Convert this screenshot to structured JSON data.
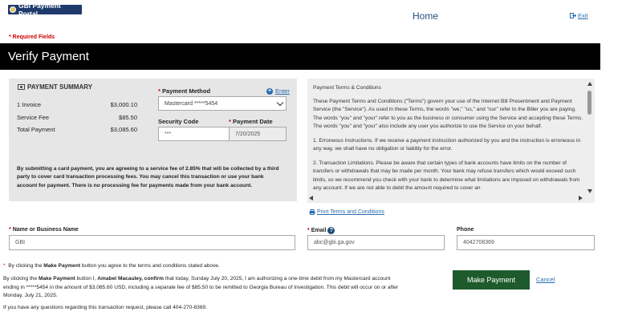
{
  "header": {
    "logo_text": "GBI Payment Portal",
    "home_label": "Home",
    "exit_label": "Exit"
  },
  "required_note": "* Required Fields",
  "banner_title": "Verify Payment",
  "summary": {
    "title": "PAYMENT SUMMARY",
    "rows": [
      {
        "label": "1 Invoice",
        "value": "$3,000.10"
      },
      {
        "label": "Service Fee",
        "value": "$85.50"
      },
      {
        "label": "Total Payment",
        "value": "$3,085.60"
      }
    ],
    "disclaimer": "By submitting a card payment, you are agreeing to a service fee of 2.85% that will be collected by a third party to cover card transaction processing fees. You may cancel this transaction or use your bank account for payment. There is no processing fee for payments made from your bank account."
  },
  "payment": {
    "method_label": "Payment Method",
    "enter_label": "Enter",
    "method_value": "Mastercard *****5454",
    "security_label": "Security Code",
    "security_value": "***",
    "date_label": "Payment Date",
    "date_value": "7/20/2025"
  },
  "terms": {
    "title": "Payment Terms & Conditions",
    "paragraphs": [
      "These Payment Terms and Conditions (\"Terms\") govern your use of the Internet Bill Presentment and Payment Service (the \"Service\"). As used in these Terms, the words \"we,\" \"us,\" and \"our\" refer to the Biller you are paying. The words \"you\" and \"your\" refer to you as the business or consumer using the Service and accepting these Terms. The words \"you\" and \"your\" also include any user you authorize to use the Service on your behalf.",
      "1. Erroneous Instructions. If we receive a payment instruction authorized by you and the instruction is erroneous in any way, we shall have no obligation or liability for the error.",
      "2. Transaction Limitations. Please be aware that certain types of bank accounts have limits on the number of transfers or withdrawals that may be made per month. Your bank may refuse transfers which would exceed such limits, so we recommend you check with your bank to determine what limitations are imposed on withdrawals from any account. If we are not able to debit the amount required to cover an"
    ],
    "print_label": "Print Terms and Conditions"
  },
  "fields": {
    "name_label": "Name or Business Name",
    "name_value": "GBI",
    "email_label": "Email",
    "email_value": "abc@gbi.ga.gov",
    "phone_label": "Phone",
    "phone_value": "4042708369"
  },
  "footer": {
    "agree_pre": "By clicking the ",
    "agree_bold": "Make Payment",
    "agree_post": " button you agree to the terms and conditions stated above.",
    "auth_pre": "By clicking the ",
    "auth_bold1": "Make Payment",
    "auth_mid": " button I, ",
    "auth_bold2": "Amabel Macauley, confirm",
    "auth_post": " that today, Sunday July 20, 2025, I am authorizing a one-time debit from my Mastercard account ending in *****5454 in the amount of $3,085.60 USD, including a separate fee of $85.50 to be remitted to Georgia Bureau of Investigation. This debit will occur on or after Monday, July 21, 2025.",
    "contact": "If you have any questions regarding this transaction request, please call 404-270-8369."
  },
  "actions": {
    "make_payment": "Make Payment",
    "cancel": "Cancel"
  },
  "colors": {
    "banner": "#000000",
    "make_payment_bg": "#1e5a2b",
    "link": "#2a6cb0",
    "required": "#cc0000"
  }
}
